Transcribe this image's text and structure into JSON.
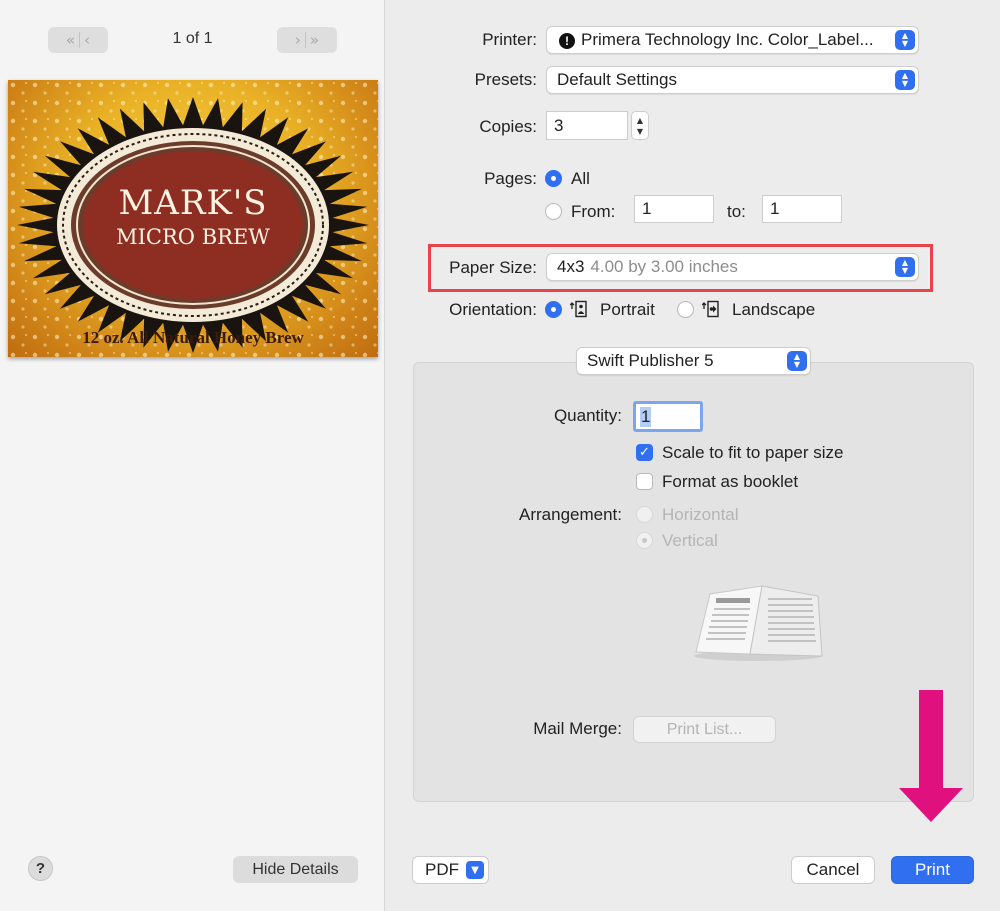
{
  "preview": {
    "page_indicator": "1 of 1",
    "first_page_glyph": "«",
    "prev_page_glyph": "‹",
    "next_page_glyph": "›",
    "last_page_glyph": "»",
    "label_title": "MARK'S",
    "label_subtitle": "MICRO BREW",
    "label_footer": "12 oz. All Natural Honey Brew"
  },
  "left_footer": {
    "help_label": "?",
    "hide_details_label": "Hide Details"
  },
  "printer": {
    "label": "Printer:",
    "value": "Primera Technology Inc. Color_Label..."
  },
  "presets": {
    "label": "Presets:",
    "value": "Default Settings"
  },
  "copies": {
    "label": "Copies:",
    "value": "3"
  },
  "pages": {
    "label": "Pages:",
    "all_label": "All",
    "from_label": "From:",
    "from_value": "1",
    "to_label": "to:",
    "to_value": "1",
    "selected": "All"
  },
  "paper_size": {
    "label": "Paper Size:",
    "name": "4x3",
    "detail": "4.00 by 3.00 inches"
  },
  "orientation": {
    "label": "Orientation:",
    "portrait_label": "Portrait",
    "landscape_label": "Landscape",
    "selected": "Portrait"
  },
  "app_options": {
    "popup_value": "Swift Publisher 5",
    "quantity_label": "Quantity:",
    "quantity_value": "1",
    "scale_to_fit_label": "Scale to fit to paper size",
    "scale_to_fit_checked": true,
    "booklet_label": "Format as booklet",
    "booklet_checked": false,
    "arrangement_label": "Arrangement:",
    "horizontal_label": "Horizontal",
    "vertical_label": "Vertical",
    "arrangement_selected": "Vertical",
    "mail_merge_label": "Mail Merge:",
    "print_list_label": "Print List..."
  },
  "footer": {
    "pdf_label": "PDF",
    "cancel_label": "Cancel",
    "print_label": "Print"
  },
  "colors": {
    "accent": "#2f6ff0",
    "highlight_box": "#e8424b",
    "annotation_arrow": "#e0117f"
  },
  "icons": {
    "printer_status": "exclamation-circle-icon",
    "portrait": "portrait-orientation-icon",
    "landscape": "landscape-orientation-icon",
    "newspaper": "folded-newspaper-icon"
  }
}
